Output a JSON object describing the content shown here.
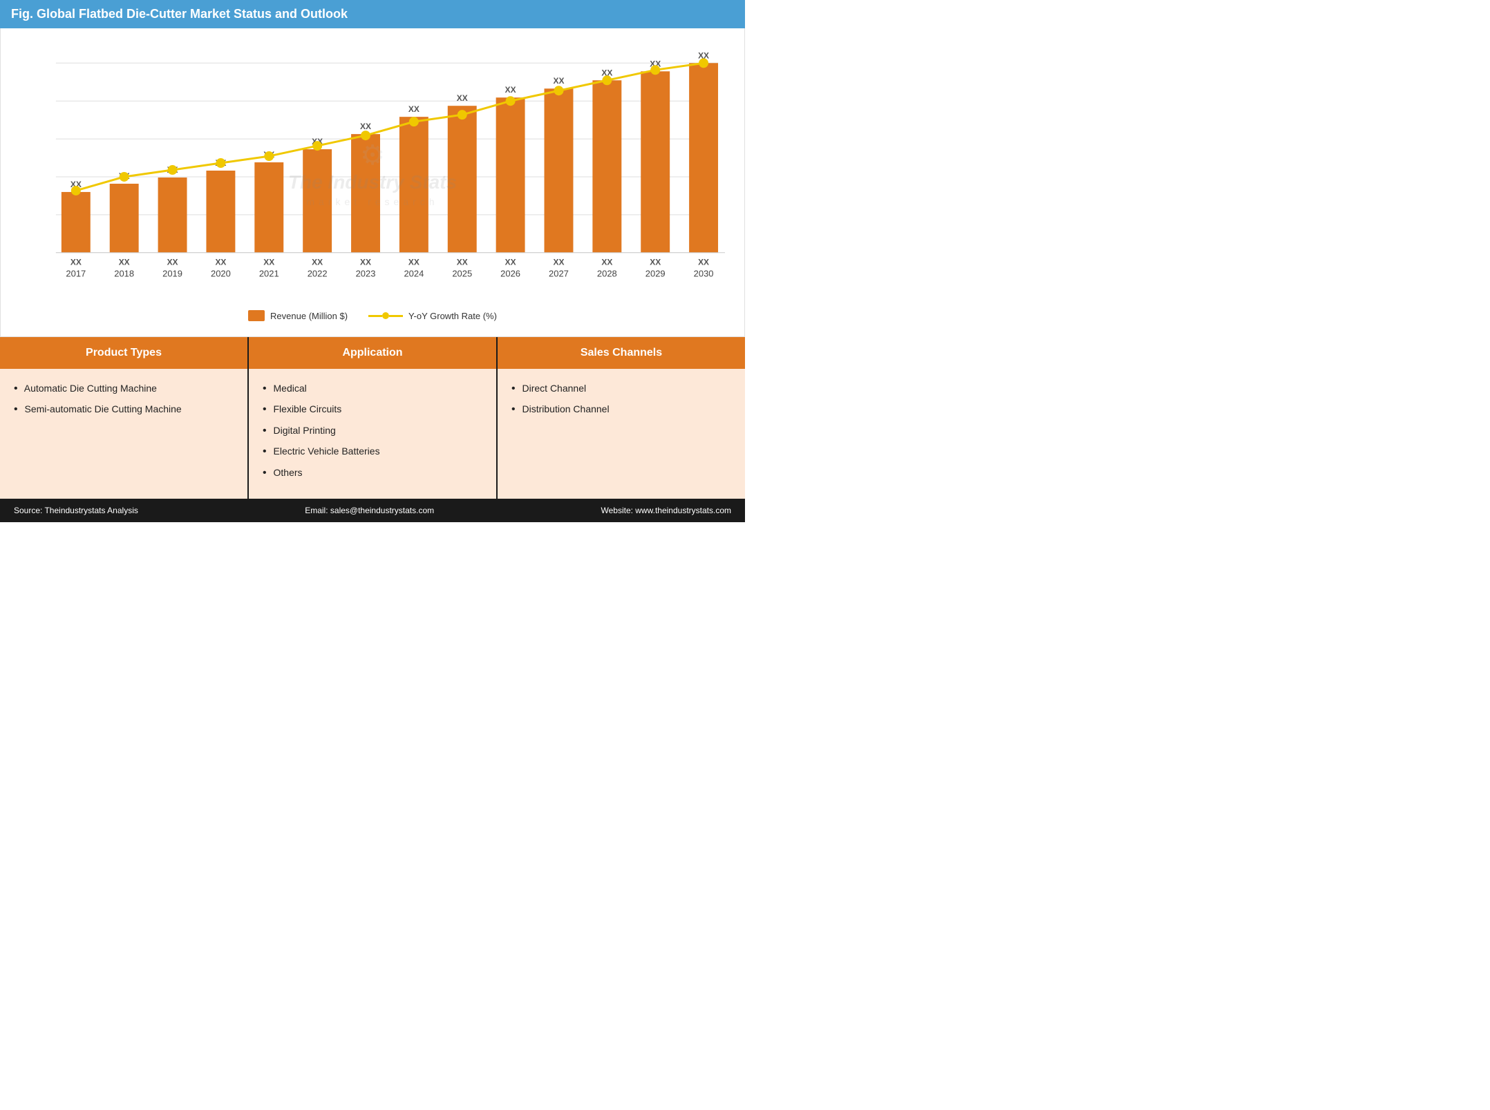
{
  "header": {
    "title": "Fig. Global Flatbed Die-Cutter Market Status and Outlook"
  },
  "chart": {
    "years": [
      "2017",
      "2018",
      "2019",
      "2020",
      "2021",
      "2022",
      "2023",
      "2024",
      "2025",
      "2026",
      "2027",
      "2028",
      "2029",
      "2030"
    ],
    "bar_label": "XX",
    "bar_values": [
      28,
      32,
      35,
      38,
      42,
      48,
      55,
      63,
      68,
      72,
      76,
      80,
      84,
      88
    ],
    "line_values": [
      18,
      22,
      24,
      26,
      28,
      31,
      34,
      38,
      40,
      44,
      47,
      50,
      53,
      55
    ],
    "legend": {
      "bar_label": "Revenue (Million $)",
      "line_label": "Y-oY Growth Rate (%)"
    },
    "bar_color": "#e07820",
    "line_color": "#f0c800",
    "grid_lines": 5
  },
  "bottom": {
    "cards": [
      {
        "id": "product-types",
        "header": "Product Types",
        "items": [
          "Automatic Die Cutting Machine",
          "Semi-automatic Die Cutting Machine"
        ]
      },
      {
        "id": "application",
        "header": "Application",
        "items": [
          "Medical",
          "Flexible Circuits",
          "Digital Printing",
          "Electric Vehicle Batteries",
          "Others"
        ]
      },
      {
        "id": "sales-channels",
        "header": "Sales Channels",
        "items": [
          "Direct Channel",
          "Distribution Channel"
        ]
      }
    ]
  },
  "footer": {
    "source": "Source: Theindustrystats Analysis",
    "email": "Email: sales@theindustrystats.com",
    "website": "Website: www.theindustrystats.com"
  },
  "watermark": {
    "title": "The Industry Stats",
    "subtitle": "market  research"
  }
}
